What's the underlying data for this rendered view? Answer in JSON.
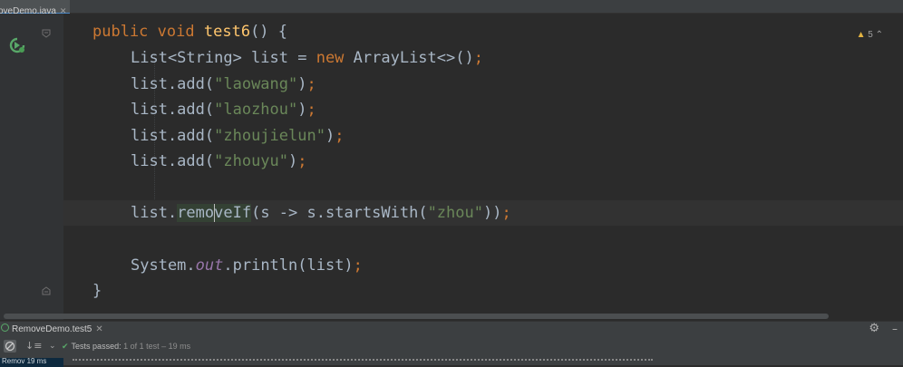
{
  "file_tab": {
    "label": "oveDemo.java",
    "close_icon": "close-icon"
  },
  "gutter": {
    "run_icon": "run-test-icon",
    "fold_icon": "fold-icon"
  },
  "inspection": {
    "warning_count": "5",
    "icon": "warning-icon"
  },
  "code": {
    "line1": {
      "kw1": "public",
      "kw2": "void",
      "method": "test6",
      "rest": "() {"
    },
    "line2": {
      "p1": "List<String> list = ",
      "kw": "new",
      "p2": " ArrayList<>()",
      "semi": ";"
    },
    "line3": {
      "p1": "list.add(",
      "str": "\"laowang\"",
      "p2": ")",
      "semi": ";"
    },
    "line4": {
      "p1": "list.add(",
      "str": "\"laozhou\"",
      "p2": ")",
      "semi": ";"
    },
    "line5": {
      "p1": "list.add(",
      "str": "\"zhoujielun\"",
      "p2": ")",
      "semi": ";"
    },
    "line6": {
      "p1": "list.add(",
      "str": "\"zhouyu\"",
      "p2": ")",
      "semi": ";"
    },
    "line7": {
      "p1": "list.",
      "hl_a": "remo",
      "hl_b": "veIf",
      "p2": "(s -> s.startsWith(",
      "str": "\"zhou\"",
      "p3": "))",
      "semi": ";"
    },
    "line8": {
      "p1": "System.",
      "field": "out",
      "p2": ".println(list)",
      "semi": ";"
    },
    "line9": {
      "text": "}"
    }
  },
  "bottom_panel": {
    "run_tab_label": "RemoveDemo.test5",
    "settings_icon": "gear-icon",
    "minimize_icon": "minimize-icon",
    "status_label": "Tests passed:",
    "status_detail": "1 of 1 test – 19 ms",
    "test_row_label": "Remov 19 ms"
  }
}
